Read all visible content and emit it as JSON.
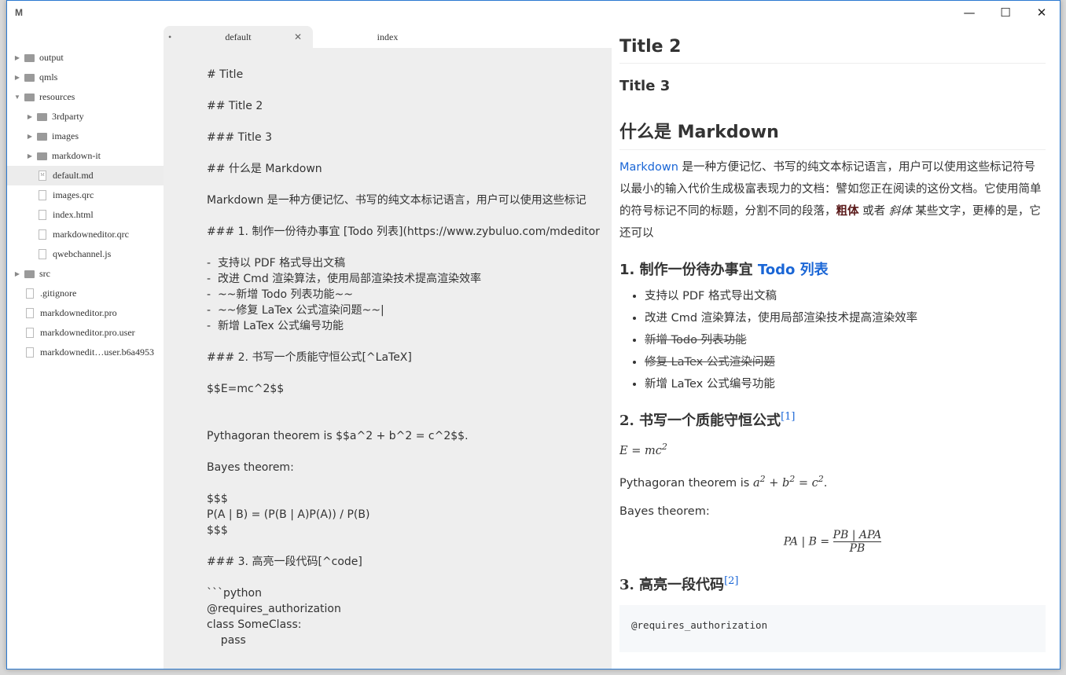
{
  "app": {
    "icon_letter": "M"
  },
  "window_controls": {
    "minimize": "—",
    "maximize": "☐",
    "close": "✕"
  },
  "tree": [
    {
      "label": "output",
      "type": "folder",
      "depth": 0,
      "expanded": false
    },
    {
      "label": "qmls",
      "type": "folder",
      "depth": 0,
      "expanded": false
    },
    {
      "label": "resources",
      "type": "folder",
      "depth": 0,
      "expanded": true
    },
    {
      "label": "3rdparty",
      "type": "folder",
      "depth": 1,
      "expanded": false
    },
    {
      "label": "images",
      "type": "folder",
      "depth": 1,
      "expanded": false
    },
    {
      "label": "markdown-it",
      "type": "folder",
      "depth": 1,
      "expanded": false
    },
    {
      "label": "default.md",
      "type": "md",
      "depth": 1,
      "selected": true
    },
    {
      "label": "images.qrc",
      "type": "file",
      "depth": 1
    },
    {
      "label": "index.html",
      "type": "file",
      "depth": 1
    },
    {
      "label": "markdowneditor.qrc",
      "type": "file",
      "depth": 1
    },
    {
      "label": "qwebchannel.js",
      "type": "file",
      "depth": 1
    },
    {
      "label": "src",
      "type": "folder",
      "depth": 0,
      "expanded": false
    },
    {
      "label": ".gitignore",
      "type": "file",
      "depth": 0
    },
    {
      "label": "markdowneditor.pro",
      "type": "file",
      "depth": 0
    },
    {
      "label": "markdowneditor.pro.user",
      "type": "file",
      "depth": 0
    },
    {
      "label": "markdownedit…user.b6a4953",
      "type": "file",
      "depth": 0
    }
  ],
  "tabs": {
    "active": "default",
    "other": "index",
    "close": "✕",
    "modified_dot": "•"
  },
  "editor": {
    "text": "# Title\n\n## Title 2\n\n### Title 3\n\n## 什么是 Markdown\n\nMarkdown 是一种方便记忆、书写的纯文本标记语言，用户可以使用这些标记\n\n### 1. 制作一份待办事宜 [Todo 列表](https://www.zybuluo.com/mdeditor\n\n-  支持以 PDF 格式导出文稿\n-  改进 Cmd 渲染算法，使用局部渲染技术提高渲染效率\n-  ~~新增 Todo 列表功能~~\n-  ~~修复 LaTex 公式渲染问题~~|\n-  新增 LaTex 公式编号功能\n\n### 2. 书写一个质能守恒公式[^LaTeX]\n\n$$E=mc^2$$\n\n\nPythagoran theorem is $$a^2 + b^2 = c^2$$.\n\nBayes theorem:\n\n$$$\nP(A | B) = (P(B | A)P(A)) / P(B)\n$$$\n\n### 3. 高亮一段代码[^code]\n\n```python\n@requires_authorization\nclass SomeClass:\n    pass"
  },
  "preview": {
    "h2": "Title 2",
    "h3": "Title 3",
    "h2b": "什么是 Markdown",
    "intro_link": "Markdown",
    "intro_a": " 是一种方便记忆、书写的纯文本标记语言，用户可以使用这些标记符号以最小的输入代价生成极富表现力的文档：譬如您正在阅读的这份文档。它使用简单的符号标记不同的标题，分割不同的段落，",
    "bold": "粗体",
    "intro_b": " 或者 ",
    "italic": "斜体",
    "intro_c": " 某些文字，更棒的是，它还可以",
    "s1_prefix": "1. 制作一份待办事宜 ",
    "s1_link": "Todo 列表",
    "list": [
      "支持以 PDF 格式导出文稿",
      "改进 Cmd 渲染算法，使用局部渲染技术提高渲染效率",
      "新增 Todo 列表功能",
      "修复 LaTex 公式渲染问题",
      "新增 LaTex 公式编号功能"
    ],
    "s2": "2. 书写一个质能守恒公式",
    "fn1": "[1]",
    "emc": "E = mc",
    "sq": "2",
    "pyth_prefix": "Pythagoran theorem is ",
    "pyth_a": "a",
    "pyth_b": " + b",
    "pyth_c": " = c",
    "pyth_end": ".",
    "bayes": "Bayes theorem:",
    "bayes_lhs": "PA | B = ",
    "bayes_num": "PB | APA",
    "bayes_den": "PB",
    "s3": "3. 高亮一段代码",
    "fn2": "[2]",
    "code": "@requires_authorization"
  }
}
